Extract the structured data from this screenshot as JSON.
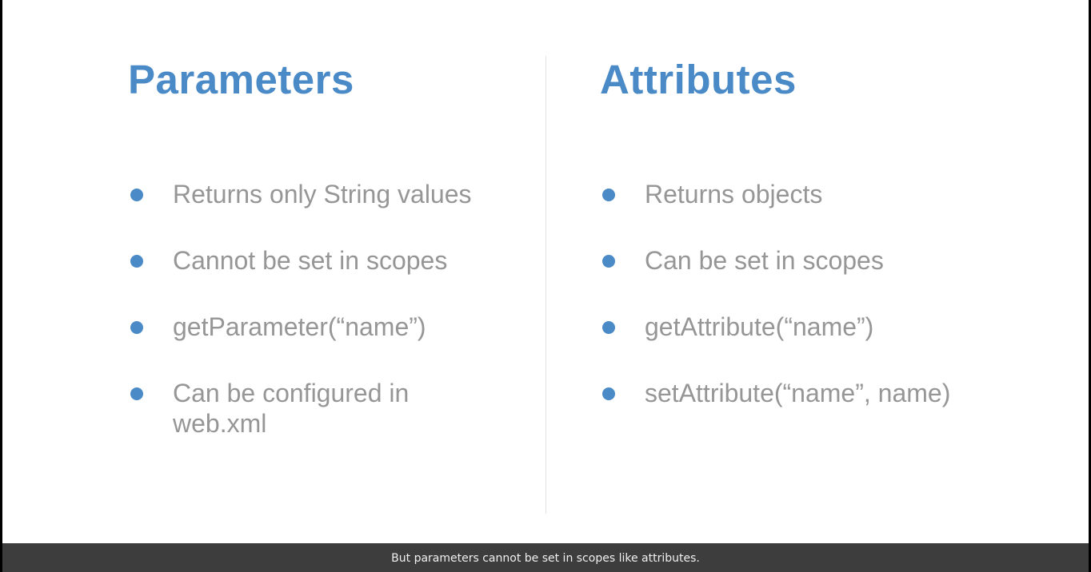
{
  "slide": {
    "left": {
      "heading": "Parameters",
      "items": [
        "Returns only String values",
        "Cannot be set in scopes",
        "getParameter(“name”)",
        "Can be configured in web.xml"
      ]
    },
    "right": {
      "heading": "Attributes",
      "items": [
        "Returns objects",
        "Can be set in scopes",
        "getAttribute(“name”)",
        "setAttribute(“name”, name)"
      ]
    }
  },
  "caption": {
    "text": "But parameters cannot be set in scopes like attributes."
  },
  "colors": {
    "accent": "#4a8ac7",
    "body_text": "#969696",
    "caption_bg": "#3d3d3d"
  }
}
